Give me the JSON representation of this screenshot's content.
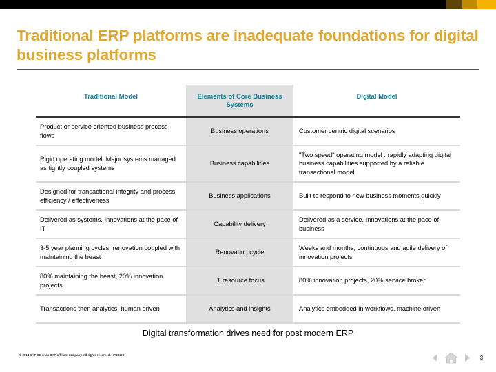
{
  "topbar": {
    "segments": [
      "#5e4406",
      "#c08a00",
      "#f5b300"
    ]
  },
  "slide": {
    "title": "Traditional ERP platforms are inadequate foundations for digital business platforms",
    "title_color": "#e0a82e",
    "caption": "Digital transformation drives need for post modern ERP"
  },
  "table": {
    "headers": {
      "col1": "Traditional Model",
      "col2": "Elements of Core Business Systems",
      "col3": "Digital Model"
    },
    "header_color": "#1b7b9e",
    "middle_column_bg": "#e0e0e0",
    "rows": [
      {
        "traditional": "Product or service oriented business process flows",
        "element": "Business operations",
        "digital": "Customer centric digital scenarios"
      },
      {
        "traditional": "Rigid operating model. Major systems managed as tightly coupled systems",
        "element": "Business capabilities",
        "digital": "\"Two speed\" operating model : rapidly adapting digital business capabilities supported by a reliable transactional model"
      },
      {
        "traditional": "Designed for transactional integrity and process efficiency / effectiveness",
        "element": "Business applications",
        "digital": "Built to respond to new business moments quickly"
      },
      {
        "traditional": "Delivered as systems. Innovations at the pace of IT",
        "element": "Capability delivery",
        "digital": "Delivered as a service. Innovations at the pace of business"
      },
      {
        "traditional": "3-5 year planning cycles, renovation coupled with maintaining the beast",
        "element": "Renovation cycle",
        "digital": "Weeks and months, continuous and agile delivery of innovation projects"
      },
      {
        "traditional": "80% maintaining the beast, 20% innovation projects",
        "element": "IT resource focus",
        "digital": "80% innovation projects, 20% service broker"
      },
      {
        "traditional": "Transactions then analytics, human driven",
        "element": "Analytics and insights",
        "digital": "Analytics embedded in workflows, machine driven"
      }
    ]
  },
  "footer": {
    "copyright": "© 2014 SAP SE or an SAP affiliate company. All rights reserved.  |  PUBLIC",
    "page_number": "3",
    "nav": {
      "previous": "previous-slide",
      "home": "home-slide",
      "next": "next-slide"
    }
  }
}
